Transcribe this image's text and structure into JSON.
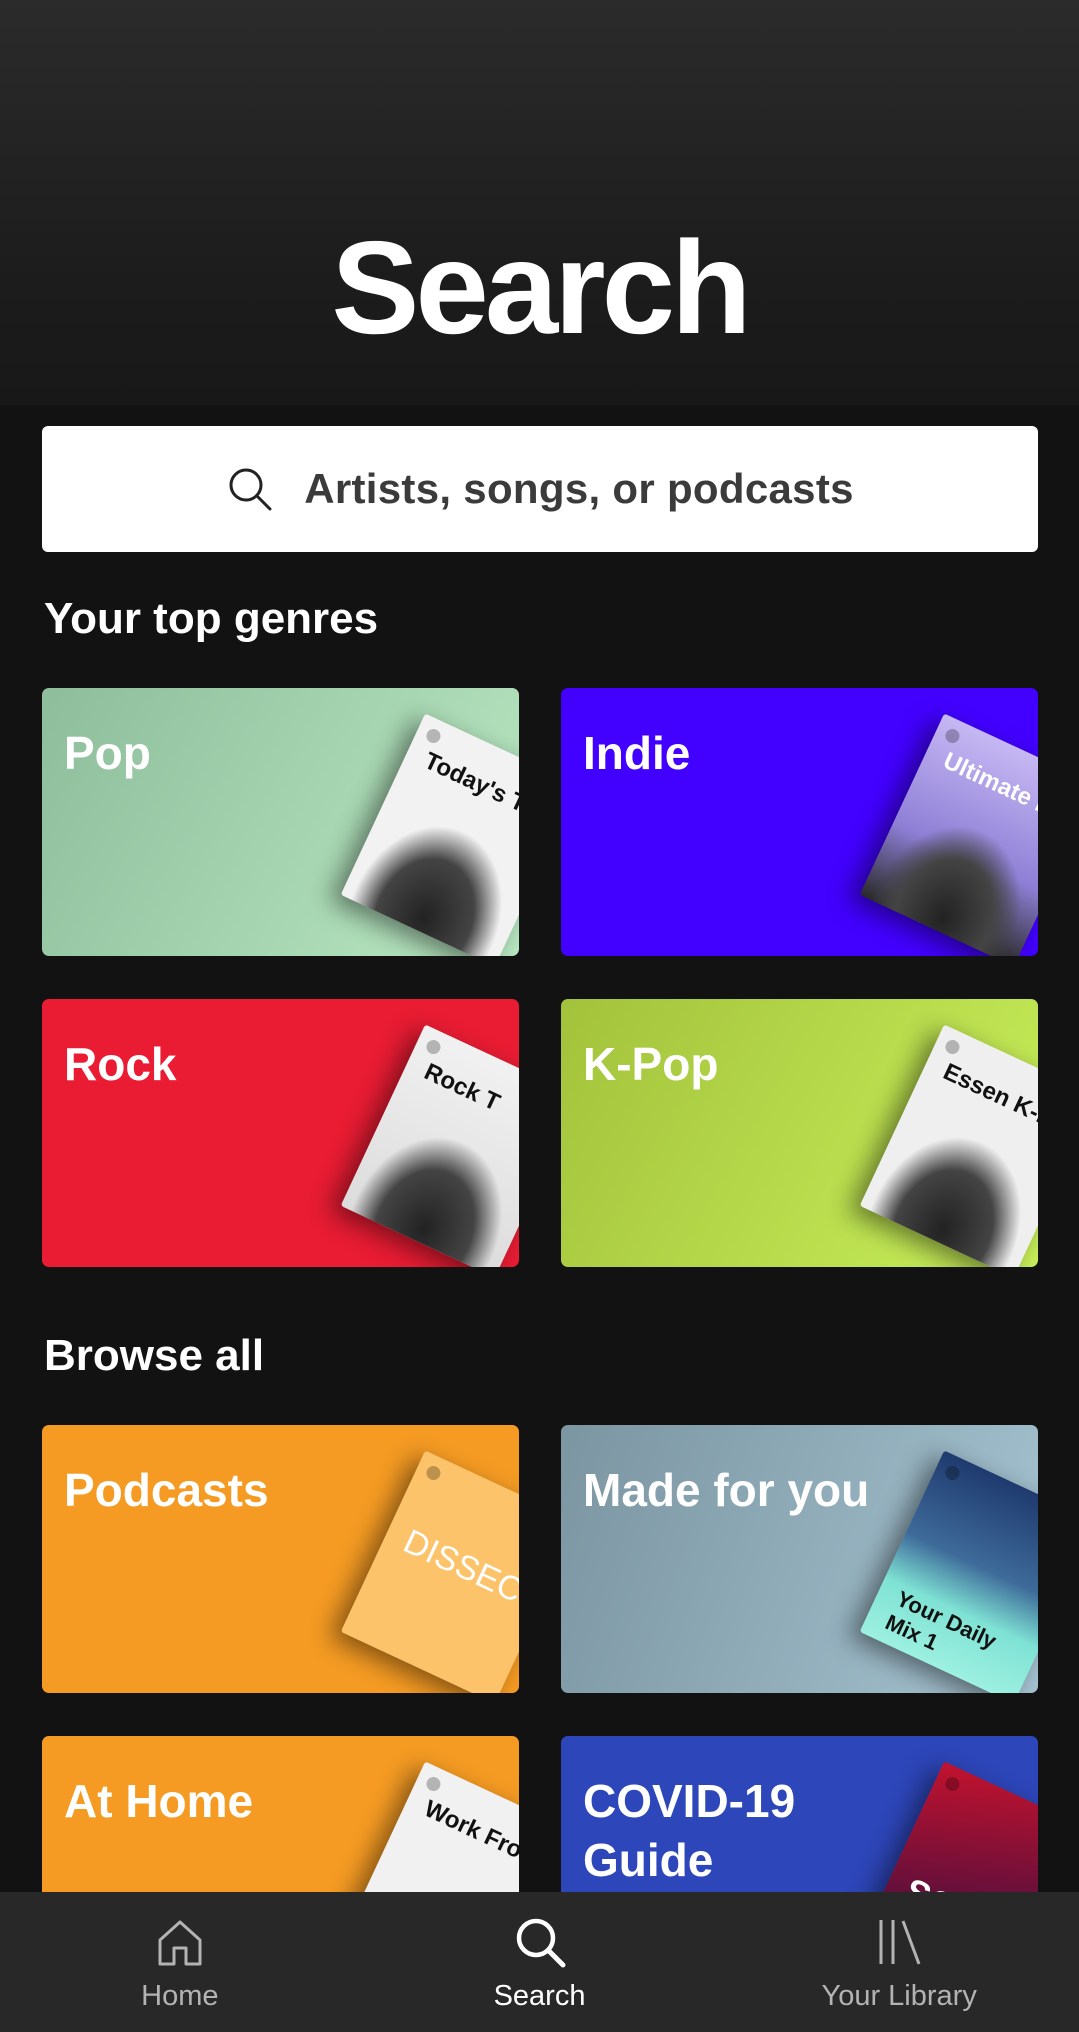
{
  "header": {
    "title": "Search"
  },
  "search": {
    "placeholder": "Artists, songs, or podcasts"
  },
  "top_genres": {
    "title": "Your top genres",
    "cards": [
      {
        "label": "Pop",
        "color": "#8fc0a0",
        "art_caption": "Today's Top H"
      },
      {
        "label": "Indie",
        "color": "#4200ff",
        "art_caption": "Ultimate I"
      },
      {
        "label": "Rock",
        "color": "#e91c33",
        "art_caption": "Rock T"
      },
      {
        "label": "K-Pop",
        "color": "#a8c83e",
        "art_caption": "Essen K-Pop"
      }
    ]
  },
  "browse_all": {
    "title": "Browse all",
    "cards": [
      {
        "label": "Podcasts",
        "color": "#f59b23",
        "art_caption": "DISSEC"
      },
      {
        "label": "Made for you",
        "color": "#8aa3ae",
        "art_caption": "Your Daily Mix 1"
      },
      {
        "label": "At Home",
        "color": "#f59b23",
        "art_caption": "Work From"
      },
      {
        "label": "COVID-19 Guide",
        "color": "#2d46b9",
        "art_caption": "SCIE"
      }
    ]
  },
  "nav": {
    "items": [
      {
        "label": "Home",
        "icon": "home-icon",
        "active": false
      },
      {
        "label": "Search",
        "icon": "search-icon",
        "active": true
      },
      {
        "label": "Your Library",
        "icon": "library-icon",
        "active": false
      }
    ]
  }
}
